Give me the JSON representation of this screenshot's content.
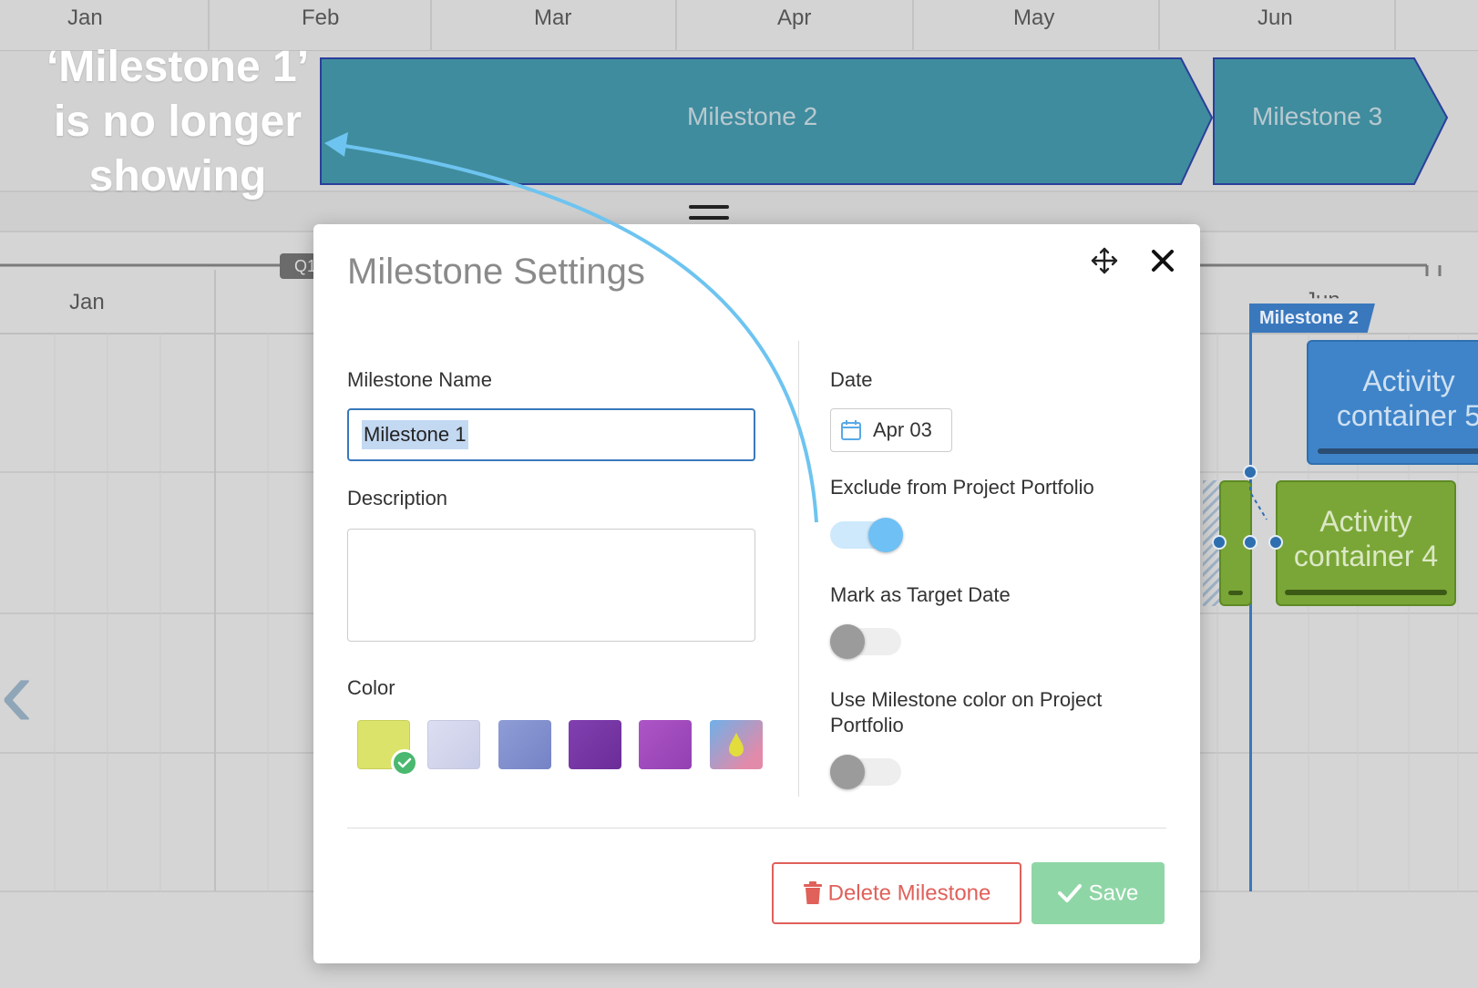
{
  "timeline_top": {
    "months": [
      "Jan",
      "Feb",
      "Mar",
      "Apr",
      "May",
      "Jun"
    ]
  },
  "timeline_bottom": {
    "months": [
      "Jan",
      "Jun"
    ],
    "quarter_tag": "Q1"
  },
  "milestone_bars": [
    {
      "label": "Milestone 2"
    },
    {
      "label": "Milestone 3"
    }
  ],
  "annotation": {
    "line1": "‘Milestone 1’",
    "line2": "is no longer",
    "line3": "showing"
  },
  "gantt": {
    "milestone_flag": "Milestone 2",
    "activity5": {
      "line1": "Activity",
      "line2": "container 5"
    },
    "activity4": {
      "line1": "Activity",
      "line2": "container 4"
    }
  },
  "modal": {
    "title": "Milestone Settings",
    "name_label": "Milestone Name",
    "name_value": "Milestone 1",
    "description_label": "Description",
    "description_value": "",
    "color_label": "Color",
    "date_label": "Date",
    "date_value": "Apr 03",
    "exclude_label": "Exclude from Project Portfolio",
    "exclude_on": true,
    "target_label": "Mark as Target Date",
    "target_on": false,
    "use_color_label": "Use Milestone color on Project Portfolio",
    "use_color_on": false,
    "delete_label": "Delete Milestone",
    "save_label": "Save"
  },
  "colors": {
    "swatches": [
      "#dbe36a",
      "#d7d9ee",
      "#8a98d4",
      "#7a3aa6",
      "#a34bbd"
    ],
    "selected_swatch": 0,
    "milestone_bar": "#3f8c9e",
    "accent": "#3a78bd",
    "toggle_on": "#6ec0f5",
    "delete": "#e0605a",
    "save": "#8fd6a6"
  }
}
